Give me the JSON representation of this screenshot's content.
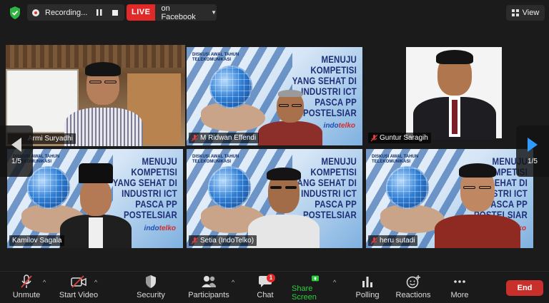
{
  "topbar": {
    "recording_label": "Recording...",
    "live_badge": "LIVE",
    "live_target": "on Facebook",
    "view_label": "View"
  },
  "slide": {
    "title_lines": [
      "MENUJU",
      "KOMPETISI",
      "YANG SEHAT DI",
      "INDUSTRI ICT",
      "PASCA PP",
      "POSTELSIAR"
    ],
    "small_title": [
      "DISKUSI AWAL TAHUN",
      "TELEKOMUNIKASI"
    ],
    "brand_a": "indo",
    "brand_b": "telko"
  },
  "tiles": [
    {
      "name": "Armi Suryadhi"
    },
    {
      "name": "M Ridwan Effendi"
    },
    {
      "name": "Guntur Saragih"
    },
    {
      "name": "Kamilov Sagala"
    },
    {
      "name": "Setia (IndoTelko)"
    },
    {
      "name": "heru sutadi"
    }
  ],
  "pager": {
    "left": "1/5",
    "right": "1/5"
  },
  "toolbar": {
    "unmute": "Unmute",
    "start_video": "Start Video",
    "security": "Security",
    "participants": "Participants",
    "chat": "Chat",
    "chat_badge": "1",
    "share_screen": "Share Screen",
    "polling": "Polling",
    "reactions": "Reactions",
    "more": "More",
    "end": "End"
  },
  "colors": {
    "active_speaker": "#c6e067",
    "live_red": "#e02a2a",
    "share_green": "#2ecc40",
    "end_red": "#c9302c",
    "pager_accent": "#2f9bff"
  }
}
